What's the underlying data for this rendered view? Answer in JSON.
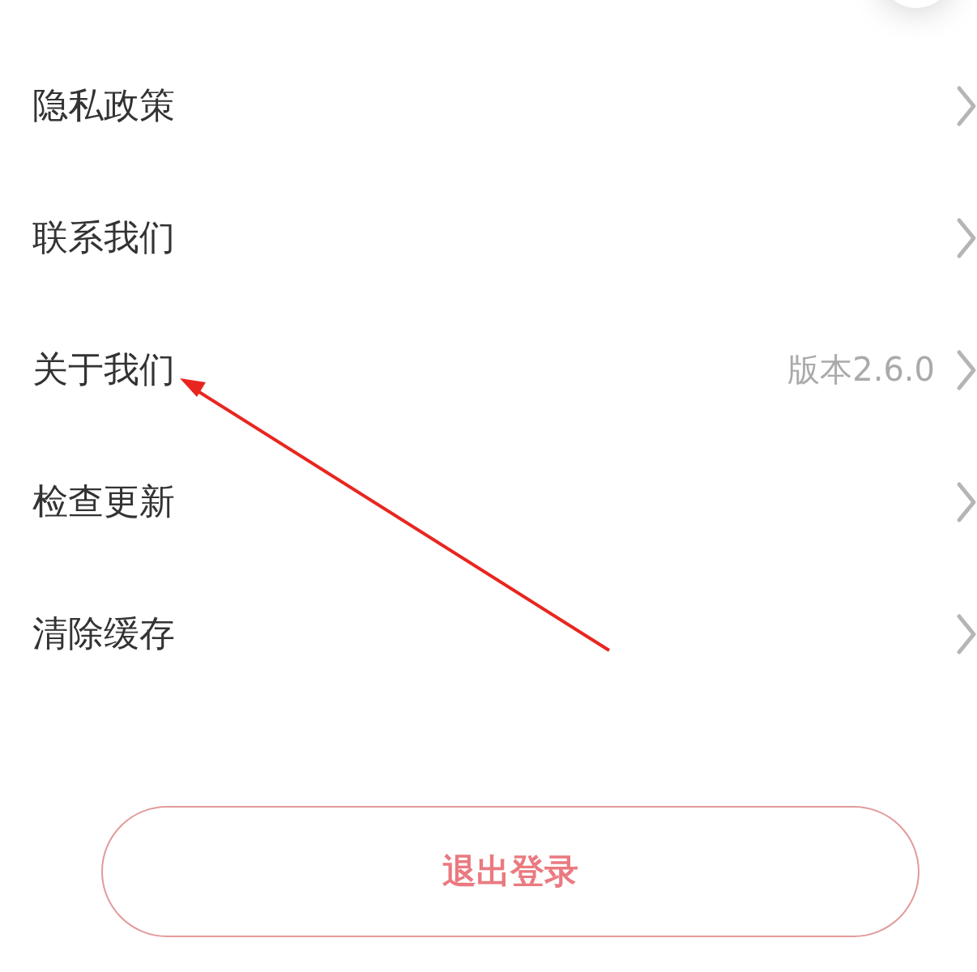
{
  "settings_items": [
    {
      "label": "隐私政策"
    },
    {
      "label": "联系我们"
    },
    {
      "label": "关于我们",
      "value": "版本2.6.0"
    },
    {
      "label": "检查更新"
    },
    {
      "label": "清除缓存"
    }
  ],
  "logout_button": {
    "label": "退出登录"
  }
}
